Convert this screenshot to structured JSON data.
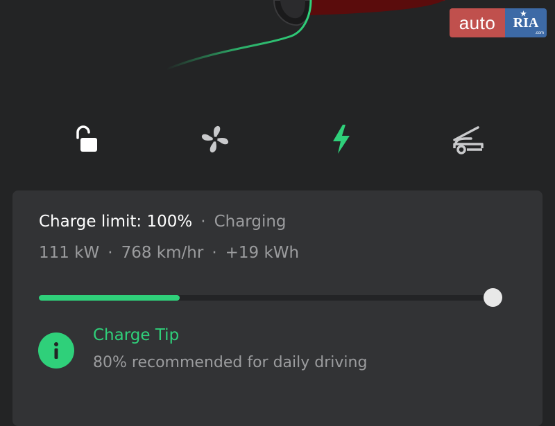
{
  "watermark": {
    "auto_text": "auto",
    "ria_text": "RIA",
    "ria_sub": ".com"
  },
  "quick_controls": [
    {
      "icon": "unlock-icon",
      "label": "Unlock",
      "color": "#ffffff"
    },
    {
      "icon": "fan-icon",
      "label": "Climate",
      "color": "#c9cacc"
    },
    {
      "icon": "lightning-icon",
      "label": "Charging",
      "color": "#2fd07a",
      "active": true
    },
    {
      "icon": "frunk-icon",
      "label": "Frunk",
      "color": "#c9cacc"
    }
  ],
  "charge": {
    "limit_label": "Charge limit: 100%",
    "dot": "·",
    "status": "Charging",
    "power": "111 kW",
    "rate": "768 km/hr",
    "energy_added": "+19 kWh",
    "current_level": 0.31,
    "limit_level": 1.0
  },
  "tip": {
    "icon": "info-icon",
    "icon_glyph": "i",
    "title": "Charge Tip",
    "text": "80% recommended for daily driving"
  },
  "colors": {
    "accent": "#2fd07a",
    "background": "#232425",
    "card": "#323335"
  }
}
